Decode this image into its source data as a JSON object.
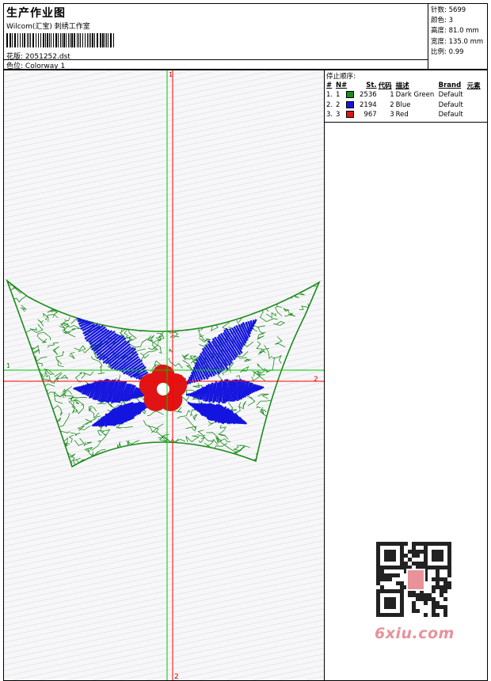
{
  "header": {
    "title": "生产作业图",
    "studio": "Wilcom(汇宝) 刺绣工作室",
    "design_label": "花版:",
    "design_value": "2051252.dst",
    "color_label": "色位:",
    "color_value": "Colorway 1"
  },
  "stats": [
    {
      "label": "针数:",
      "value": "5699"
    },
    {
      "label": "颜色:",
      "value": "3"
    },
    {
      "label": "高度:",
      "value": "81.0 mm"
    },
    {
      "label": "宽度:",
      "value": "135.0 mm"
    },
    {
      "label": "比例:",
      "value": "0.99"
    }
  ],
  "stop_sequence": {
    "title": "停止顺序:",
    "columns": [
      "#",
      "N#",
      "St.",
      "代码",
      "描述",
      "Brand",
      "元素"
    ],
    "rows": [
      {
        "idx": "1.",
        "n": "1",
        "color": "#1a8c1a",
        "stitches": "2536",
        "code": "1",
        "desc": "Dark Green",
        "brand": "Default"
      },
      {
        "idx": "2.",
        "n": "2",
        "color": "#1414e0",
        "stitches": "2194",
        "code": "2",
        "desc": "Blue",
        "brand": "Default"
      },
      {
        "idx": "3.",
        "n": "3",
        "color": "#e01414",
        "stitches": "967",
        "code": "3",
        "desc": "Red",
        "brand": "Default"
      }
    ]
  },
  "axes": {
    "top_v": "1",
    "bottom_v": "2",
    "left_h": "1",
    "right_h": "2"
  },
  "colors": {
    "green": "#1a8c1a",
    "blue": "#1414e0",
    "red": "#e01414",
    "guide_green": "#00c800",
    "guide_red": "#ff0000"
  },
  "watermark": "6xiu.com"
}
